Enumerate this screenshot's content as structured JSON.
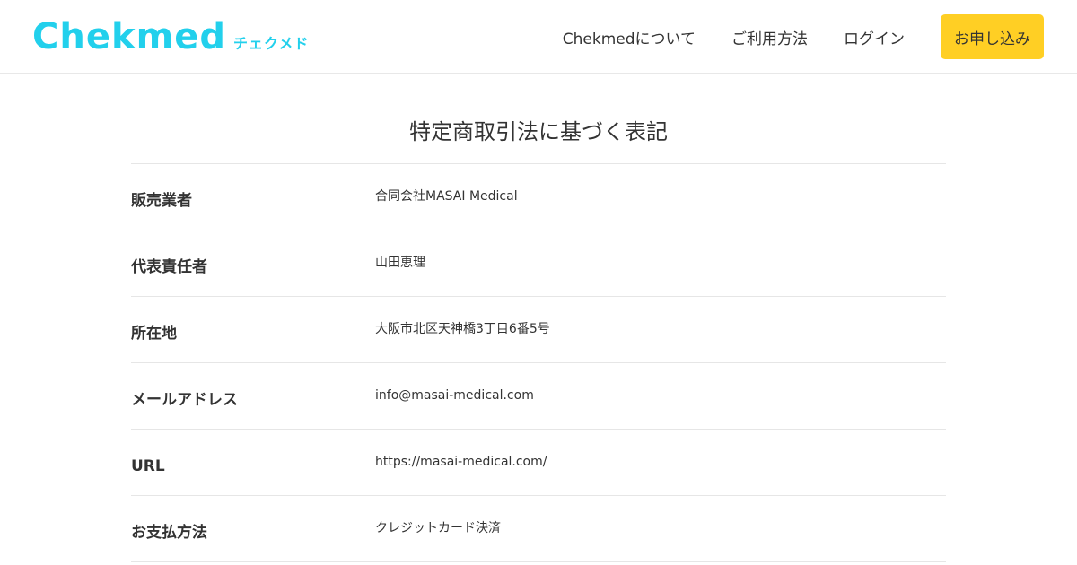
{
  "header": {
    "logo": {
      "main": "Chekmed",
      "sub": "チェクメド",
      "color": "#22d0ec"
    },
    "nav": {
      "about": "Chekmedについて",
      "usage": "ご利用方法",
      "login": "ログイン",
      "apply": "お申し込み"
    },
    "apply_button_color": "#ffcf24"
  },
  "main": {
    "title": "特定商取引法に基づく表記",
    "rows": [
      {
        "label": "販売業者",
        "value": "合同会社MASAI Medical"
      },
      {
        "label": "代表責任者",
        "value": "山田恵理"
      },
      {
        "label": "所在地",
        "value": "大阪市北区天神橋3丁目6番5号"
      },
      {
        "label": "メールアドレス",
        "value": "info@masai-medical.com"
      },
      {
        "label": "URL",
        "value": "https://masai-medical.com/"
      },
      {
        "label": "お支払方法",
        "value": "クレジットカード決済"
      }
    ]
  }
}
